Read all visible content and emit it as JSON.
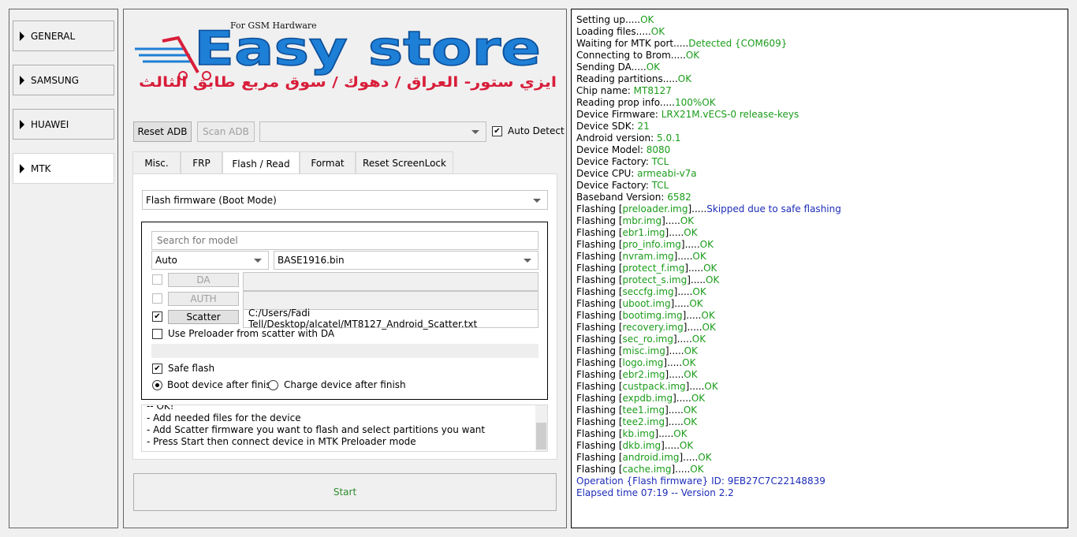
{
  "sidebar": {
    "items": [
      {
        "label": "GENERAL",
        "active": false
      },
      {
        "label": "SAMSUNG",
        "active": false
      },
      {
        "label": "HUAWEI",
        "active": false
      },
      {
        "label": "MTK",
        "active": true
      }
    ]
  },
  "logo": {
    "tagline": "For GSM Hardware",
    "title": "Easy store",
    "arabic_subtitle": "ايزي ستور- العراق / دهوك / سوق مربع طابق الثالث"
  },
  "adb_bar": {
    "reset_adb": "Reset ADB",
    "scan_adb": "Scan ADB",
    "device_combo_value": "",
    "auto_detect_label": "Auto Detect",
    "auto_detect_checked": true
  },
  "tabs": [
    {
      "label": "Misc.",
      "active": false
    },
    {
      "label": "FRP",
      "active": false
    },
    {
      "label": "Flash / Read",
      "active": true
    },
    {
      "label": "Format",
      "active": false
    },
    {
      "label": "Reset ScreenLock",
      "active": false
    }
  ],
  "flash_panel": {
    "mode_select": "Flash firmware (Boot Mode)",
    "search_placeholder": "Search for model",
    "model_select": "Auto",
    "firmware_select": "BASE1916.bin",
    "da_button": "DA",
    "auth_button": "AUTH",
    "scatter_button": "Scatter",
    "scatter_checked": true,
    "scatter_path": "C:/Users/Fadi Tell/Desktop/alcatel/MT8127_Android_Scatter.txt",
    "use_preloader_label": "Use Preloader from scatter with DA",
    "use_preloader_checked": false,
    "safe_flash_label": "Safe flash",
    "safe_flash_checked": true,
    "boot_after_label": "Boot device after finish",
    "charge_after_label": "Charge device after finish",
    "selected_finish_option": "boot"
  },
  "info_lines": [
    "-- OK!",
    "- Add needed files for the device",
    "- Add Scatter firmware you want to flash and select partitions you want",
    "- Press Start then connect device in MTK Preloader mode"
  ],
  "start_button": "Start",
  "log": [
    [
      [
        "Setting up.....",
        "k"
      ],
      [
        "OK",
        "g"
      ]
    ],
    [
      [
        "Loading files.....",
        "k"
      ],
      [
        "OK",
        "g"
      ]
    ],
    [
      [
        "Waiting for MTK port.....",
        "k"
      ],
      [
        "Detected {COM609}",
        "g"
      ]
    ],
    [
      [
        "Connecting to Brom.....",
        "k"
      ],
      [
        "OK",
        "g"
      ]
    ],
    [
      [
        "Sending DA.....",
        "k"
      ],
      [
        "OK",
        "g"
      ]
    ],
    [
      [
        "Reading partitions.....",
        "k"
      ],
      [
        "OK",
        "g"
      ]
    ],
    [
      [
        "Chip name: ",
        "k"
      ],
      [
        "MT8127",
        "g"
      ]
    ],
    [
      [
        "Reading prop info.....",
        "k"
      ],
      [
        "100%OK",
        "g"
      ]
    ],
    [
      [
        "Device Firmware: ",
        "k"
      ],
      [
        "LRX21M.vECS-0 release-keys",
        "g"
      ]
    ],
    [
      [
        "Device SDK: ",
        "k"
      ],
      [
        "21",
        "g"
      ]
    ],
    [
      [
        "Android version: ",
        "k"
      ],
      [
        "5.0.1",
        "g"
      ]
    ],
    [
      [
        "Device Model: ",
        "k"
      ],
      [
        "8080",
        "g"
      ]
    ],
    [
      [
        "Device Factory: ",
        "k"
      ],
      [
        "TCL",
        "g"
      ]
    ],
    [
      [
        "Device CPU: ",
        "k"
      ],
      [
        "armeabi-v7a",
        "g"
      ]
    ],
    [
      [
        "Device Factory: ",
        "k"
      ],
      [
        "TCL",
        "g"
      ]
    ],
    [
      [
        "Baseband Version: ",
        "k"
      ],
      [
        "6582",
        "g"
      ]
    ],
    [
      [
        "Flashing [",
        "k"
      ],
      [
        "preloader.img",
        "g"
      ],
      [
        "].....",
        "k"
      ],
      [
        "Skipped due to safe flashing",
        "b"
      ]
    ],
    [
      [
        "Flashing [",
        "k"
      ],
      [
        "mbr.img",
        "g"
      ],
      [
        "].....",
        "k"
      ],
      [
        "OK",
        "g"
      ]
    ],
    [
      [
        "Flashing [",
        "k"
      ],
      [
        "ebr1.img",
        "g"
      ],
      [
        "].....",
        "k"
      ],
      [
        "OK",
        "g"
      ]
    ],
    [
      [
        "Flashing [",
        "k"
      ],
      [
        "pro_info.img",
        "g"
      ],
      [
        "].....",
        "k"
      ],
      [
        "OK",
        "g"
      ]
    ],
    [
      [
        "Flashing [",
        "k"
      ],
      [
        "nvram.img",
        "g"
      ],
      [
        "].....",
        "k"
      ],
      [
        "OK",
        "g"
      ]
    ],
    [
      [
        "Flashing [",
        "k"
      ],
      [
        "protect_f.img",
        "g"
      ],
      [
        "].....",
        "k"
      ],
      [
        "OK",
        "g"
      ]
    ],
    [
      [
        "Flashing [",
        "k"
      ],
      [
        "protect_s.img",
        "g"
      ],
      [
        "].....",
        "k"
      ],
      [
        "OK",
        "g"
      ]
    ],
    [
      [
        "Flashing [",
        "k"
      ],
      [
        "seccfg.img",
        "g"
      ],
      [
        "].....",
        "k"
      ],
      [
        "OK",
        "g"
      ]
    ],
    [
      [
        "Flashing [",
        "k"
      ],
      [
        "uboot.img",
        "g"
      ],
      [
        "].....",
        "k"
      ],
      [
        "OK",
        "g"
      ]
    ],
    [
      [
        "Flashing [",
        "k"
      ],
      [
        "bootimg.img",
        "g"
      ],
      [
        "].....",
        "k"
      ],
      [
        "OK",
        "g"
      ]
    ],
    [
      [
        "Flashing [",
        "k"
      ],
      [
        "recovery.img",
        "g"
      ],
      [
        "].....",
        "k"
      ],
      [
        "OK",
        "g"
      ]
    ],
    [
      [
        "Flashing [",
        "k"
      ],
      [
        "sec_ro.img",
        "g"
      ],
      [
        "].....",
        "k"
      ],
      [
        "OK",
        "g"
      ]
    ],
    [
      [
        "Flashing [",
        "k"
      ],
      [
        "misc.img",
        "g"
      ],
      [
        "].....",
        "k"
      ],
      [
        "OK",
        "g"
      ]
    ],
    [
      [
        "Flashing [",
        "k"
      ],
      [
        "logo.img",
        "g"
      ],
      [
        "].....",
        "k"
      ],
      [
        "OK",
        "g"
      ]
    ],
    [
      [
        "Flashing [",
        "k"
      ],
      [
        "ebr2.img",
        "g"
      ],
      [
        "].....",
        "k"
      ],
      [
        "OK",
        "g"
      ]
    ],
    [
      [
        "Flashing [",
        "k"
      ],
      [
        "custpack.img",
        "g"
      ],
      [
        "].....",
        "k"
      ],
      [
        "OK",
        "g"
      ]
    ],
    [
      [
        "Flashing [",
        "k"
      ],
      [
        "expdb.img",
        "g"
      ],
      [
        "].....",
        "k"
      ],
      [
        "OK",
        "g"
      ]
    ],
    [
      [
        "Flashing [",
        "k"
      ],
      [
        "tee1.img",
        "g"
      ],
      [
        "].....",
        "k"
      ],
      [
        "OK",
        "g"
      ]
    ],
    [
      [
        "Flashing [",
        "k"
      ],
      [
        "tee2.img",
        "g"
      ],
      [
        "].....",
        "k"
      ],
      [
        "OK",
        "g"
      ]
    ],
    [
      [
        "Flashing [",
        "k"
      ],
      [
        "kb.img",
        "g"
      ],
      [
        "].....",
        "k"
      ],
      [
        "OK",
        "g"
      ]
    ],
    [
      [
        "Flashing [",
        "k"
      ],
      [
        "dkb.img",
        "g"
      ],
      [
        "].....",
        "k"
      ],
      [
        "OK",
        "g"
      ]
    ],
    [
      [
        "Flashing [",
        "k"
      ],
      [
        "android.img",
        "g"
      ],
      [
        "].....",
        "k"
      ],
      [
        "OK",
        "g"
      ]
    ],
    [
      [
        "Flashing [",
        "k"
      ],
      [
        "cache.img",
        "g"
      ],
      [
        "].....",
        "k"
      ],
      [
        "OK",
        "g"
      ]
    ],
    [
      [
        "Operation {Flash firmware} ID: 9EB27C7C22148839",
        "b"
      ]
    ],
    [
      [
        "Elapsed time 07:19 -- Version 2.2",
        "b"
      ]
    ]
  ],
  "colors": {
    "ok_green": "#1a9c1a",
    "info_blue": "#1d2db8",
    "logo_blue": "#1e7fd6",
    "logo_red": "#d81e3a",
    "start_text": "#2e8b2e"
  }
}
